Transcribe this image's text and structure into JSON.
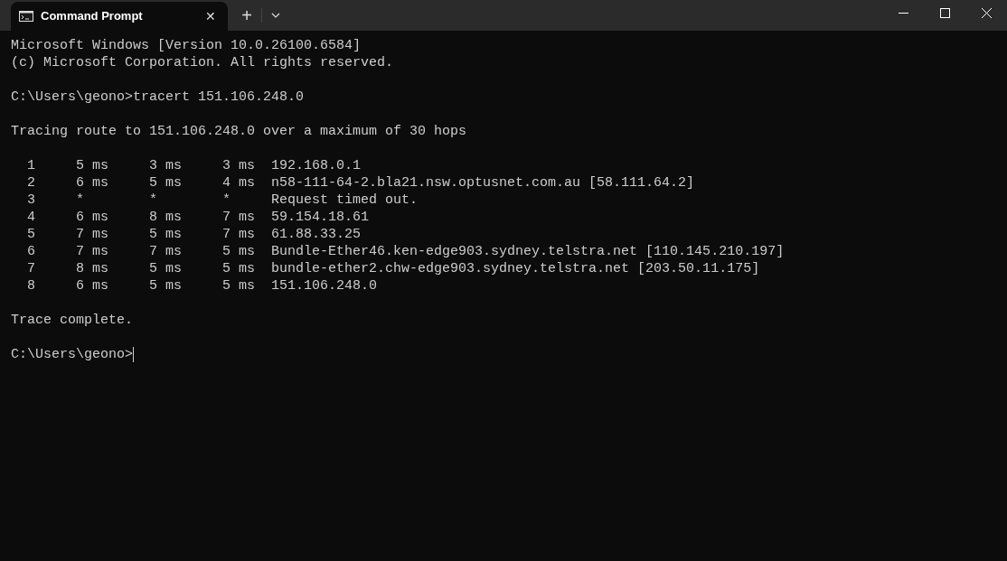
{
  "window": {
    "tab": {
      "title": "Command Prompt",
      "close": "✕",
      "selected": true
    },
    "new_tab": "+"
  },
  "blocks": [
    [
      "Microsoft Windows [Version 10.0.26100.6584]",
      "(c) Microsoft Corporation. All rights reserved."
    ],
    [
      "C:\\Users\\geono>tracert 151.106.248.0"
    ],
    [
      "Tracing route to 151.106.248.0 over a maximum of 30 hops"
    ],
    [
      "  1     5 ms     3 ms     3 ms  192.168.0.1",
      "  2     6 ms     5 ms     4 ms  n58-111-64-2.bla21.nsw.optusnet.com.au [58.111.64.2]",
      "  3     *        *        *     Request timed out.",
      "  4     6 ms     8 ms     7 ms  59.154.18.61",
      "  5     7 ms     5 ms     7 ms  61.88.33.25",
      "  6     7 ms     7 ms     5 ms  Bundle-Ether46.ken-edge903.sydney.telstra.net [110.145.210.197]",
      "  7     8 ms     5 ms     5 ms  bundle-ether2.chw-edge903.sydney.telstra.net [203.50.11.175]",
      "  8     6 ms     5 ms     5 ms  151.106.248.0"
    ],
    [
      "Trace complete."
    ]
  ],
  "prompt": {
    "text": "C:\\Users\\geono>",
    "cursor": true
  }
}
